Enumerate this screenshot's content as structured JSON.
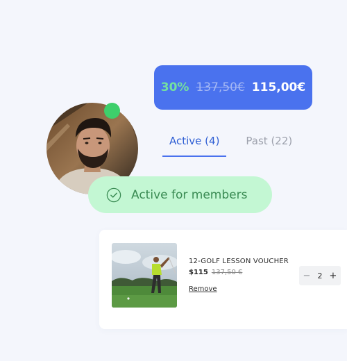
{
  "price_pill": {
    "discount": "30%",
    "old_price": "137,50€",
    "new_price": "115,00€",
    "color": "#4a72ee"
  },
  "avatar": {
    "icon": "user-avatar",
    "status_color": "#3ecf6b"
  },
  "tabs": [
    {
      "label": "Active (4)",
      "active": true
    },
    {
      "label": "Past (22)",
      "active": false
    }
  ],
  "members_badge": {
    "label": "Active for members",
    "icon": "check-circle-icon",
    "background": "#c3f7d3",
    "text_color": "#3a8b53"
  },
  "cart_item": {
    "name": "12-GOLF LESSON VOUCHER",
    "price": "$115",
    "old_price": "137,50 €",
    "remove_label": "Remove",
    "quantity": "2",
    "minus": "−",
    "plus": "+"
  }
}
